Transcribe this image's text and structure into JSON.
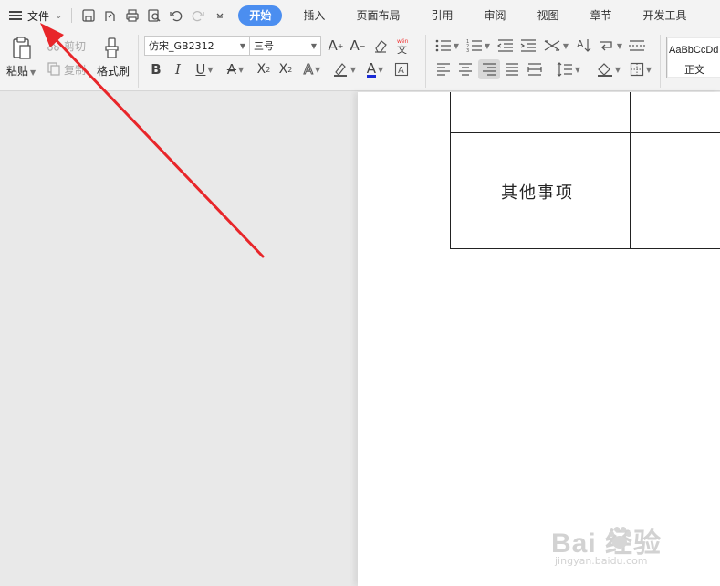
{
  "titlebar": {
    "file_menu_label": "文件",
    "tabs": [
      "开始",
      "插入",
      "页面布局",
      "引用",
      "审阅",
      "视图",
      "章节",
      "开发工具"
    ]
  },
  "ribbon": {
    "paste_label": "粘贴",
    "cut_label": "剪切",
    "copy_label": "复制",
    "format_painter_label": "格式刷",
    "font_name": "仿宋_GB2312",
    "font_size": "三号",
    "style_preview": "AaBbCcDd",
    "style_name": "正文"
  },
  "document": {
    "table_cell_text": "其他事项"
  },
  "watermark": {
    "brand": "Bai  经验",
    "url": "jingyan.baidu.com"
  },
  "colors": {
    "active_tab": "#4b8ef0",
    "annotation_arrow": "#e8262a",
    "font_color_underline": "#1a2bd6"
  }
}
